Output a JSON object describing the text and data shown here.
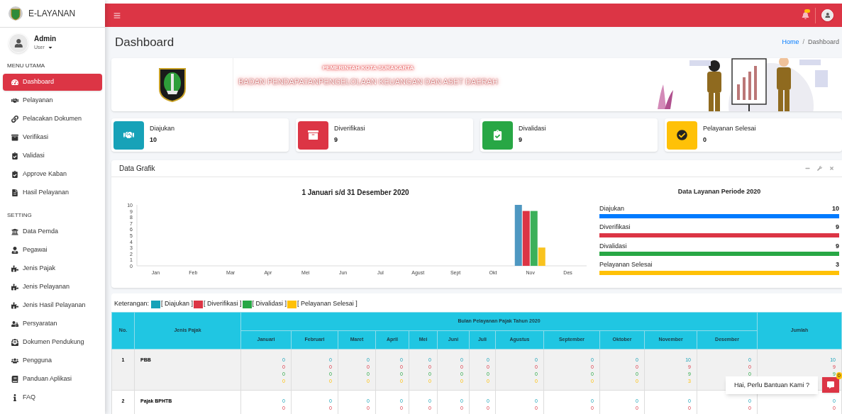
{
  "sidebar": {
    "brand": "E-LAYANAN",
    "user": {
      "name": "Admin",
      "role": "User"
    },
    "sections": [
      {
        "title": "MENU UTAMA",
        "items": [
          {
            "label": "Dashboard",
            "selected": true
          },
          {
            "label": "Pelayanan",
            "selected": false
          },
          {
            "label": "Pelacakan Dokumen",
            "selected": false
          },
          {
            "label": "Verifikasi",
            "selected": false
          },
          {
            "label": "Validasi",
            "selected": false
          },
          {
            "label": "Approve Kaban",
            "selected": false
          },
          {
            "label": "Hasil Pelayanan",
            "selected": false
          }
        ]
      },
      {
        "title": "SETTING",
        "items": [
          {
            "label": "Data Pemda",
            "selected": false
          },
          {
            "label": "Pegawai",
            "selected": false
          },
          {
            "label": "Jenis Pajak",
            "selected": false
          },
          {
            "label": "Jenis Pelayanan",
            "selected": false
          },
          {
            "label": "Jenis Hasil Pelayanan",
            "selected": false
          },
          {
            "label": "Persyaratan",
            "selected": false
          },
          {
            "label": "Dokumen Pendukung",
            "selected": false
          },
          {
            "label": "Pengguna",
            "selected": false
          },
          {
            "label": "Panduan Aplikasi",
            "selected": false
          },
          {
            "label": "FAQ",
            "selected": false
          }
        ]
      }
    ]
  },
  "page": {
    "title": "Dashboard",
    "breadcrumb_separator": "/",
    "breadcrumb": [
      {
        "label": "Home",
        "kind": "link"
      },
      {
        "label": "Dashboard",
        "kind": "current"
      }
    ]
  },
  "banner": {
    "subtitle": "PEMERINTAH KOTA SURAKARTA",
    "title": "BADAN PENDAPATANPENGELOLAAN KEUANGAN DAN ASET DAERAH"
  },
  "info_boxes": [
    {
      "label": "Diajukan",
      "value": "10",
      "color": "#17a2b8"
    },
    {
      "label": "Diverifikasi",
      "value": "9",
      "color": "#dc3545"
    },
    {
      "label": "Divalidasi",
      "value": "9",
      "color": "#28a745"
    },
    {
      "label": "Pelayanan Selesai",
      "value": "0",
      "color": "#ffc107"
    }
  ],
  "grafik": {
    "title": "Data Grafik",
    "chart_data": {
      "type": "bar",
      "title": "1 Januari s/d 31 Desember 2020",
      "categories": [
        "Jan",
        "Feb",
        "Mar",
        "Apr",
        "Mei",
        "Jun",
        "Jul",
        "Agust",
        "Sept",
        "Okt",
        "Nov",
        "Des"
      ],
      "ylim": [
        0,
        10
      ],
      "yticks": [
        0,
        1,
        2,
        3,
        4,
        5,
        6,
        7,
        8,
        9,
        10
      ],
      "series": [
        {
          "color": "#4e97c1",
          "values": [
            0,
            0,
            0,
            0,
            0,
            0,
            0,
            0,
            0,
            0,
            10,
            0
          ]
        },
        {
          "color": "#dc3545",
          "values": [
            0,
            0,
            0,
            0,
            0,
            0,
            0,
            0,
            0,
            0,
            9,
            0
          ]
        },
        {
          "color": "#3cb05a",
          "values": [
            0,
            0,
            0,
            0,
            0,
            0,
            0,
            0,
            0,
            0,
            9,
            0
          ]
        },
        {
          "color": "#f9c31f",
          "values": [
            0,
            0,
            0,
            0,
            0,
            0,
            0,
            0,
            0,
            0,
            3,
            0
          ]
        }
      ]
    },
    "period": {
      "title": "Data Layanan Periode 2020",
      "items": [
        {
          "label": "Diajukan",
          "value": "10",
          "level": 1,
          "color": "#007bff"
        },
        {
          "label": "Diverifikasi",
          "value": "9",
          "level": 1,
          "color": "#dc3545"
        },
        {
          "label": "Divalidasi",
          "value": "9",
          "level": 1,
          "color": "#28a745"
        },
        {
          "label": "Pelayanan Selesai",
          "value": "3",
          "level": 1,
          "color": "#ffc107"
        }
      ]
    }
  },
  "table": {
    "legend_label": "Keterangan:",
    "legend": [
      {
        "label": "[ Diajukan ]",
        "color": "#17a2b8"
      },
      {
        "label": "[ Diverifikasi ]",
        "color": "#dc3545"
      },
      {
        "label": "[ Divalidasi ]",
        "color": "#28a745"
      },
      {
        "label": "[ Pelayanan Selesai ]",
        "color": "#ffc107"
      }
    ],
    "no_header": "No.",
    "type_header": "Jenis Pajak",
    "group_header": "Bulan Pelayanan Pajak Tahun 2020",
    "total_header": "Jumlah",
    "months": [
      "Januari",
      "Februari",
      "Maret",
      "April",
      "Mei",
      "Juni",
      "Juli",
      "Agustus",
      "September",
      "Oktober",
      "November",
      "Desember"
    ],
    "rows": [
      {
        "no": "1",
        "type": "PBB",
        "cells": [
          [
            "0",
            "0",
            "0",
            "0"
          ],
          [
            "0",
            "0",
            "0",
            "0"
          ],
          [
            "0",
            "0",
            "0",
            "0"
          ],
          [
            "0",
            "0",
            "0",
            "0"
          ],
          [
            "0",
            "0",
            "0",
            "0"
          ],
          [
            "0",
            "0",
            "0",
            "0"
          ],
          [
            "0",
            "0",
            "0",
            "0"
          ],
          [
            "0",
            "0",
            "0",
            "0"
          ],
          [
            "0",
            "0",
            "0",
            "0"
          ],
          [
            "0",
            "0",
            "0",
            "0"
          ],
          [
            "10",
            "9",
            "9",
            "3"
          ],
          [
            "0",
            "0",
            "0"
          ]
        ],
        "total": [
          "10",
          "9",
          "9"
        ]
      },
      {
        "no": "2",
        "type": "Pajak BPHTB",
        "cells": [
          [
            "0",
            "0"
          ],
          [
            "0",
            "0"
          ],
          [
            "0",
            "0"
          ],
          [
            "0",
            "0"
          ],
          [
            "0",
            "0"
          ],
          [
            "0",
            "0"
          ],
          [
            "0",
            "0"
          ],
          [
            "0",
            "0"
          ],
          [
            "0",
            "0"
          ],
          [
            "0",
            "0"
          ],
          [
            "0",
            "0"
          ],
          [
            "0",
            "0"
          ]
        ],
        "total": [
          "0",
          "0"
        ]
      }
    ]
  },
  "chat": {
    "prompt": "Hai, Perlu Bantuan Kami ?",
    "badge": "0"
  }
}
